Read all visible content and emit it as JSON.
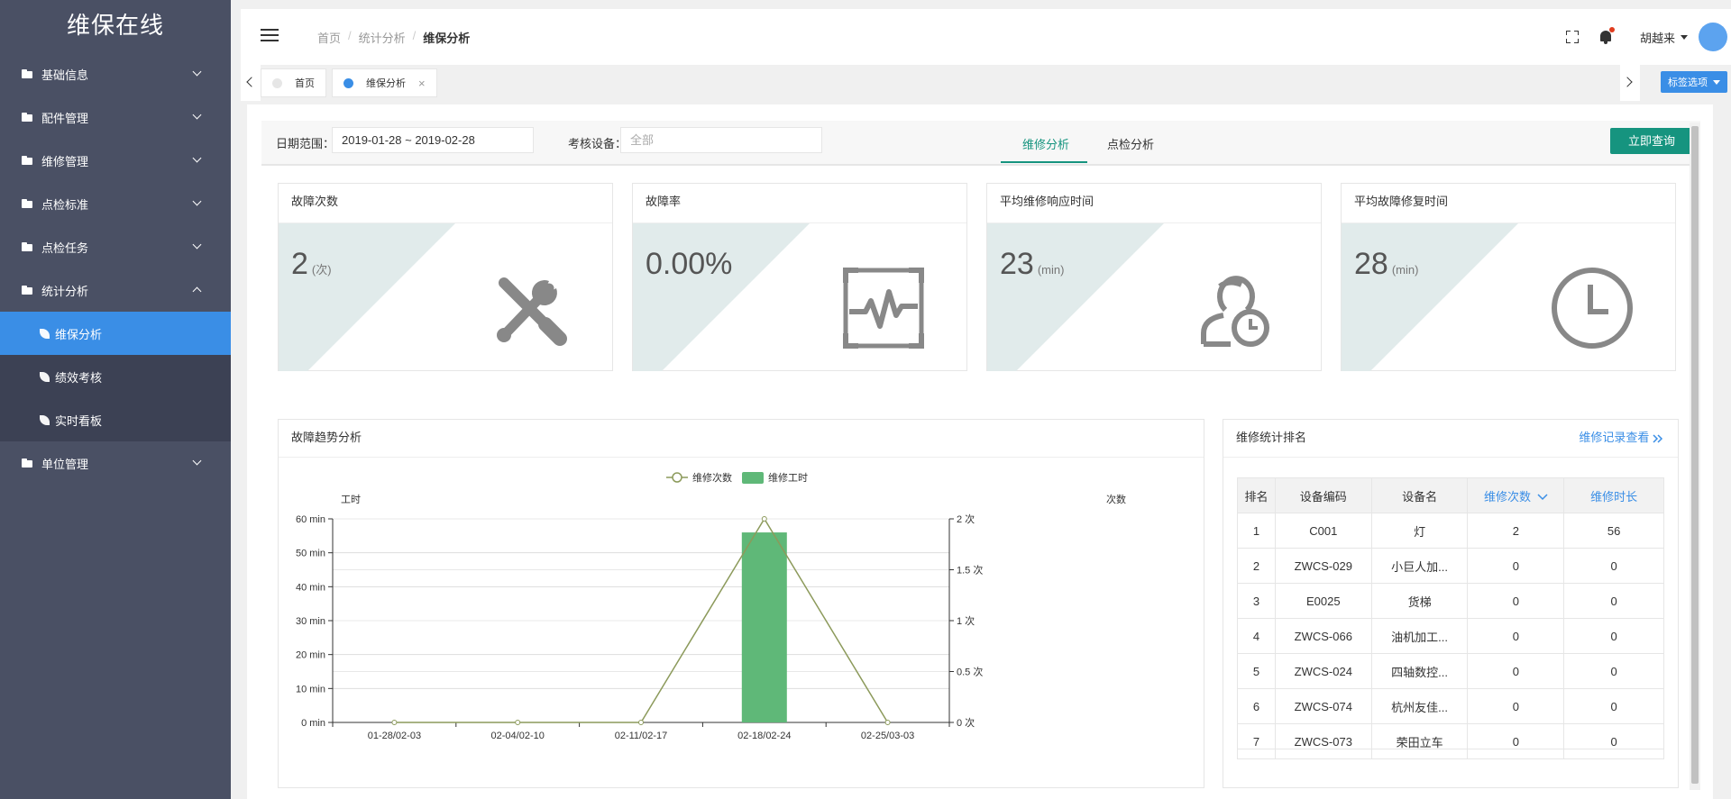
{
  "app": {
    "title": "维保在线"
  },
  "sidebar": {
    "items": [
      {
        "label": "基础信息"
      },
      {
        "label": "配件管理"
      },
      {
        "label": "维修管理"
      },
      {
        "label": "点检标准"
      },
      {
        "label": "点检任务"
      },
      {
        "label": "统计分析",
        "expanded": true,
        "children": [
          {
            "label": "维保分析",
            "active": true
          },
          {
            "label": "绩效考核"
          },
          {
            "label": "实时看板"
          }
        ]
      },
      {
        "label": "单位管理"
      }
    ]
  },
  "header": {
    "breadcrumb": [
      "首页",
      "统计分析",
      "维保分析"
    ],
    "user": "胡越来"
  },
  "tabs": {
    "items": [
      {
        "label": "首页"
      },
      {
        "label": "维保分析",
        "active": true
      }
    ],
    "close": "×",
    "tag_options": "标签选项"
  },
  "filter": {
    "date_label": "日期范围：",
    "date_value": "2019-01-28 ~ 2019-02-28",
    "device_label": "考核设备：",
    "device_placeholder": "全部",
    "tabs": [
      "维修分析",
      "点检分析"
    ],
    "active_tab": 0,
    "query_button": "立即查询"
  },
  "stats": [
    {
      "title": "故障次数",
      "value": "2",
      "unit": "(次)",
      "icon": "wrench-screwdriver-icon"
    },
    {
      "title": "故障率",
      "value": "0.00%",
      "unit": "",
      "icon": "pulse-monitor-icon"
    },
    {
      "title": "平均维修响应时间",
      "value": "23",
      "unit": "(min)",
      "icon": "user-clock-icon"
    },
    {
      "title": "平均故障修复时间",
      "value": "28",
      "unit": "(min)",
      "icon": "clock-icon"
    }
  ],
  "trend": {
    "title": "故障趋势分析"
  },
  "chart_data": {
    "type": "bar",
    "categories": [
      "01-28/02-03",
      "02-04/02-10",
      "02-11/02-17",
      "02-18/02-24",
      "02-25/03-03"
    ],
    "series": [
      {
        "name": "维修次数",
        "type": "line",
        "axis": "right",
        "values": [
          0,
          0,
          0,
          2,
          0
        ]
      },
      {
        "name": "维修工时",
        "type": "bar",
        "axis": "left",
        "values": [
          0,
          0,
          0,
          56,
          0
        ]
      }
    ],
    "y_left": {
      "label": "工时",
      "ylim": [
        0,
        60
      ],
      "ticks": [
        "0 min",
        "10 min",
        "20 min",
        "30 min",
        "40 min",
        "50 min",
        "60 min"
      ],
      "tick_values": [
        0,
        10,
        20,
        30,
        40,
        50,
        60
      ]
    },
    "y_right": {
      "label": "次数",
      "ylim": [
        0,
        2
      ],
      "ticks": [
        "0 次",
        "0.5 次",
        "1 次",
        "1.5 次",
        "2 次"
      ],
      "tick_values": [
        0,
        0.5,
        1,
        1.5,
        2
      ]
    },
    "colors": {
      "line": "#8c9a5b",
      "bar": "#5fb878"
    },
    "legend_position": "top-center",
    "grid": true
  },
  "rank": {
    "title": "维修统计排名",
    "more_link": "维修记录查看",
    "columns": [
      "排名",
      "设备编码",
      "设备名",
      "维修次数",
      "维修时长"
    ],
    "rows": [
      [
        "1",
        "C001",
        "灯",
        "2",
        "56"
      ],
      [
        "2",
        "ZWCS-029",
        "小巨人加...",
        "0",
        "0"
      ],
      [
        "3",
        "E0025",
        "货梯",
        "0",
        "0"
      ],
      [
        "4",
        "ZWCS-066",
        "油机加工...",
        "0",
        "0"
      ],
      [
        "5",
        "ZWCS-024",
        "四轴数控...",
        "0",
        "0"
      ],
      [
        "6",
        "ZWCS-074",
        "杭州友佳...",
        "0",
        "0"
      ],
      [
        "7",
        "ZWCS-073",
        "荣田立车",
        "0",
        "0"
      ]
    ]
  },
  "colors": {
    "sidebar": "#4a5064",
    "accent": "#3a8ee6",
    "primary": "#16947f"
  }
}
